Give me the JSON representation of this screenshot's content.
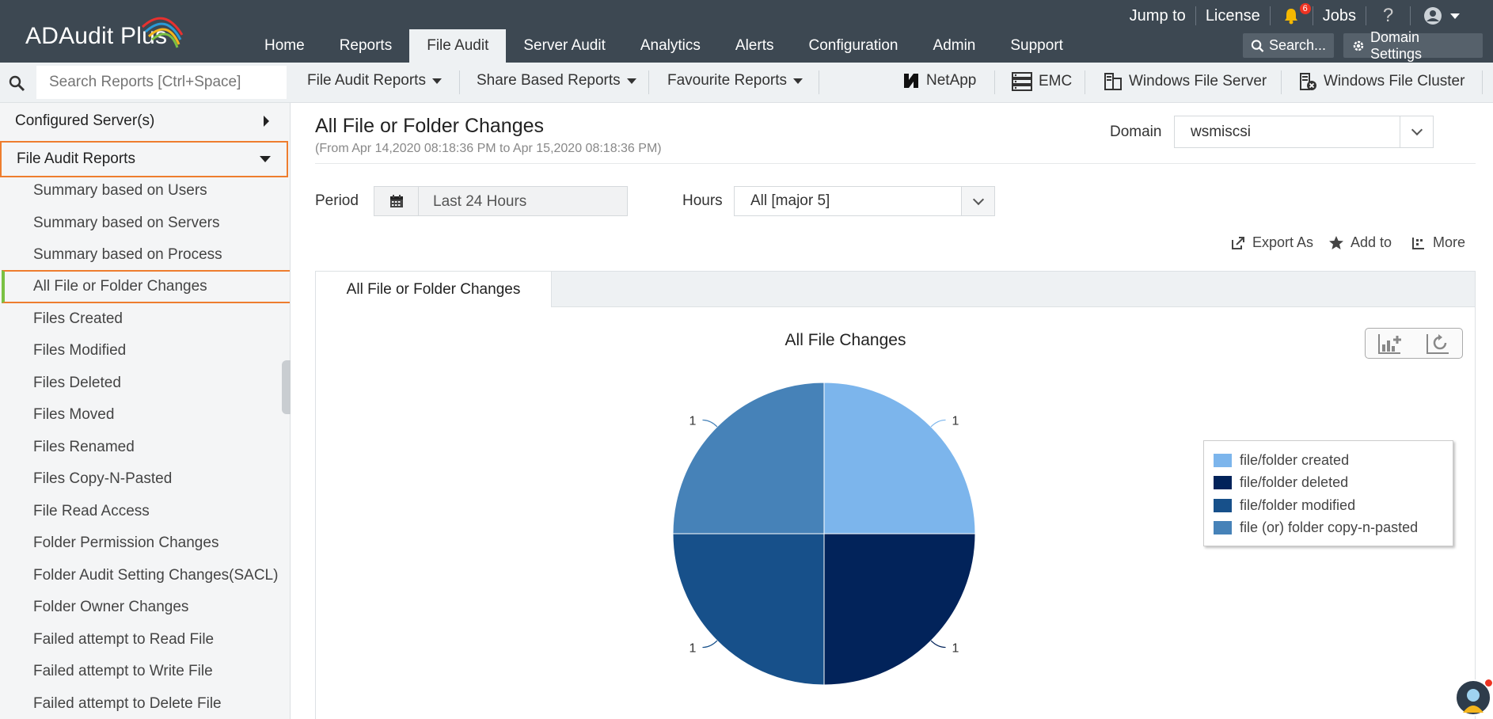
{
  "app": {
    "logo_text": "ADAudit Plus"
  },
  "top_links": {
    "jump_to": "Jump to",
    "license": "License",
    "notifications_count": "6",
    "jobs": "Jobs",
    "help": "?"
  },
  "nav_tabs": [
    "Home",
    "Reports",
    "File Audit",
    "Server Audit",
    "Analytics",
    "Alerts",
    "Configuration",
    "Admin",
    "Support"
  ],
  "active_tab": "File Audit",
  "header_buttons": {
    "search": "Search...",
    "domain_settings": "Domain Settings"
  },
  "subbar": {
    "search_placeholder": "Search Reports [Ctrl+Space]",
    "menus": [
      "File Audit Reports",
      "Share Based Reports",
      "Favourite Reports"
    ],
    "servers": [
      "NetApp",
      "EMC",
      "Windows File Server",
      "Windows File Cluster"
    ]
  },
  "sidebar": {
    "configured_servers": "Configured Server(s)",
    "file_audit_reports": "File Audit Reports",
    "items": [
      "Summary based on Users",
      "Summary based on Servers",
      "Summary based on Process",
      "All File or Folder Changes",
      "Files Created",
      "Files Modified",
      "Files Deleted",
      "Files Moved",
      "Files Renamed",
      "Files Copy-N-Pasted",
      "File Read Access",
      "Folder Permission Changes",
      "Folder Audit Setting Changes(SACL)",
      "Folder Owner Changes",
      "Failed attempt to Read File",
      "Failed attempt to Write File",
      "Failed attempt to Delete File"
    ],
    "selected_index": 3
  },
  "main": {
    "title": "All File or Folder Changes",
    "subtitle": "(From Apr 14,2020 08:18:36 PM to Apr 15,2020 08:18:36 PM)",
    "domain_label": "Domain",
    "domain_value": "wsmiscsi",
    "period_label": "Period",
    "period_value": "Last 24 Hours",
    "hours_label": "Hours",
    "hours_value": "All [major 5]",
    "actions": {
      "export": "Export As",
      "add_to": "Add to",
      "more": "More"
    },
    "result_tab": "All File or Folder Changes"
  },
  "chart_data": {
    "type": "pie",
    "title": "All File Changes",
    "categories": [
      "file/folder created",
      "file/folder deleted",
      "file/folder modified",
      "file (or) folder copy-n-pasted"
    ],
    "values": [
      1,
      1,
      1,
      1
    ],
    "colors": [
      "#7cb5ec",
      "#02235a",
      "#17508a",
      "#4682b8"
    ],
    "legend_position": "right"
  }
}
